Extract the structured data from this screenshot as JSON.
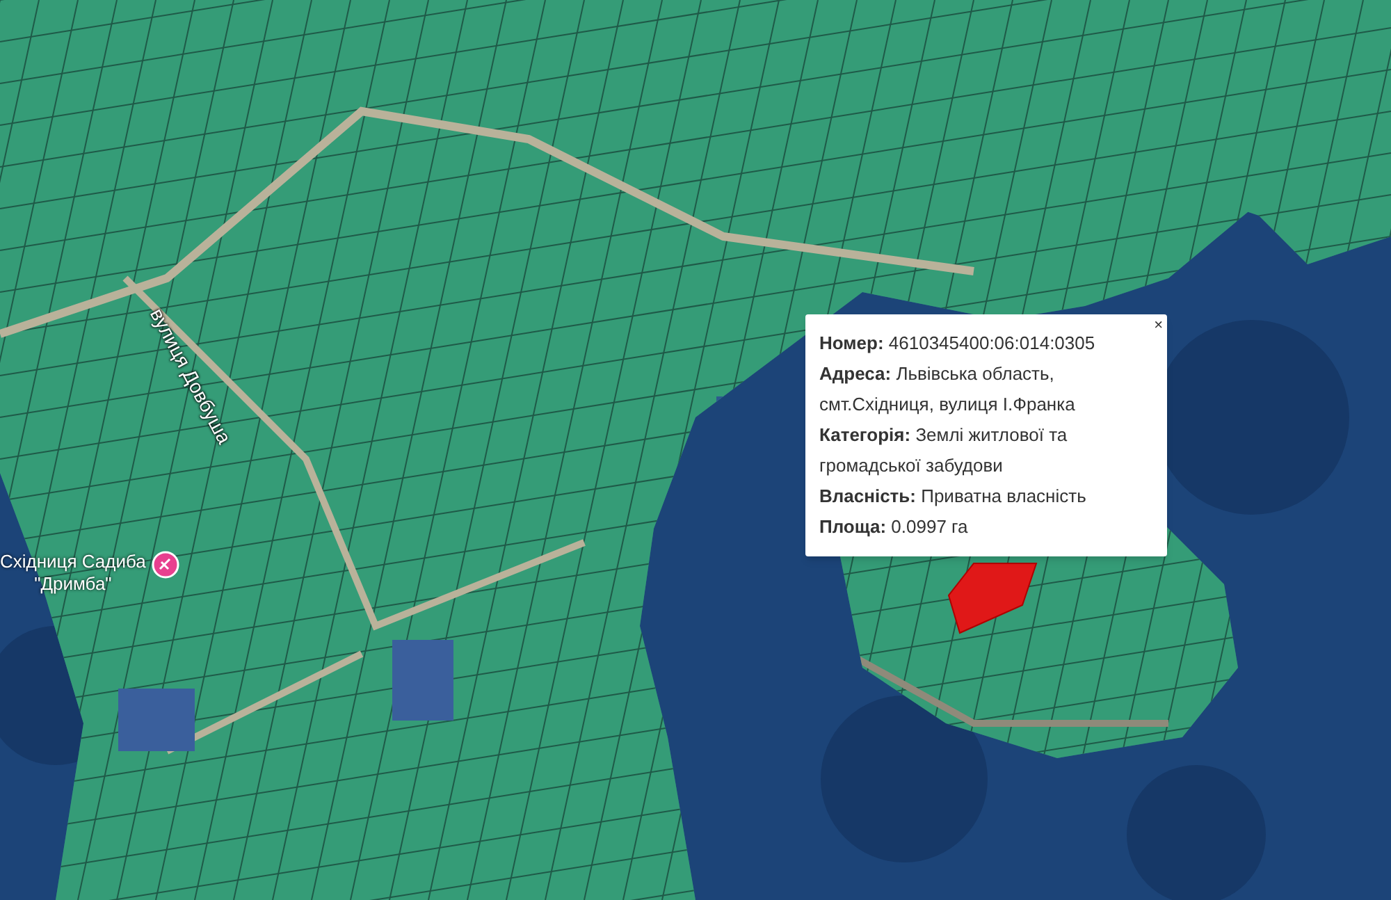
{
  "map_labels": [
    {
      "kind": "place",
      "lines": [
        "Східниця Садиба",
        "\"Дримба\""
      ]
    },
    {
      "kind": "street",
      "lines": [
        "вулиця Довбуша"
      ]
    }
  ],
  "popup": {
    "close": "×",
    "fields": [
      "**Номер:** 4610345400:06:014:0305",
      "**Адреса:** Львівська область, смт.Східниця, вулиця І.Франка",
      "**Категорія:** Землі житлової та громадської забудови",
      "**Власність:** Приватна власність",
      "**Площа:** 0.0997 га"
    ]
  }
}
